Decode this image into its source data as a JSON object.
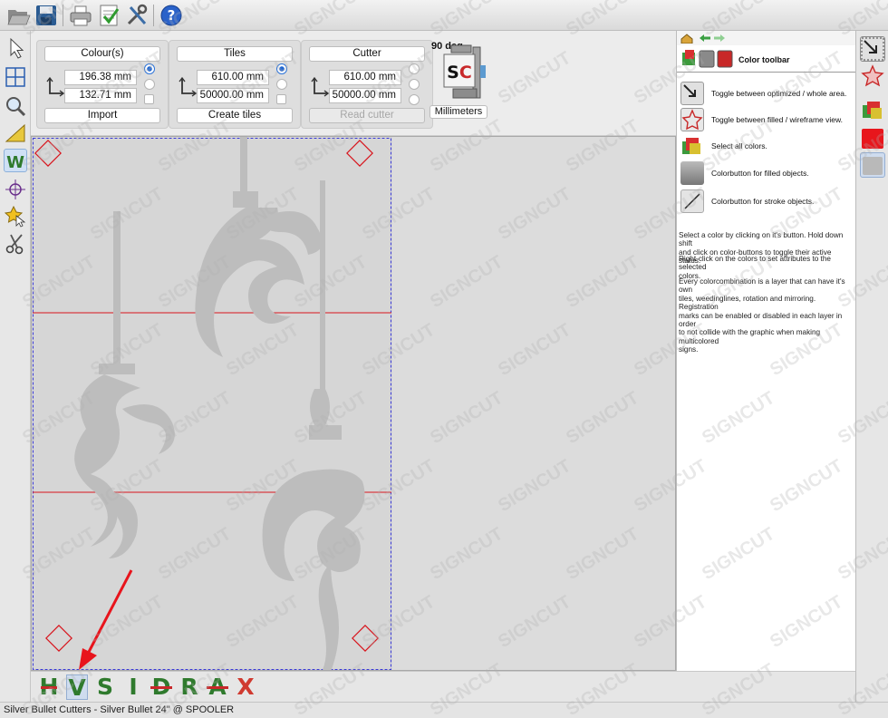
{
  "toolbar": {
    "icons": [
      "folder-open-icon",
      "save-icon",
      "print-icon",
      "checklist-icon",
      "tools-icon",
      "help-icon"
    ]
  },
  "left_tools": [
    "pointer-icon",
    "grid-icon",
    "zoom-icon",
    "ruler-icon",
    "weed-icon",
    "crosshair-icon",
    "star-select-icon",
    "scissors-icon"
  ],
  "params": {
    "colours": {
      "title": "Colour(s)",
      "field1": "196.38 mm",
      "field2": "132.71 mm",
      "button": "Import"
    },
    "tiles": {
      "title": "Tiles",
      "field1": "610.00 mm",
      "field2": "50000.00 mm",
      "button": "Create tiles"
    },
    "cutter": {
      "title": "Cutter",
      "field1": "610.00 mm",
      "field2": "50000.00 mm",
      "button": "Read cutter"
    },
    "rotation": "90 deg",
    "units": "Millimeters"
  },
  "color_bar": {
    "letters": [
      "H",
      "V",
      "S",
      "I",
      "D",
      "R",
      "A",
      "X"
    ],
    "active_index": 1
  },
  "status": "Silver Bullet Cutters - Silver Bullet 24\" @ SPOOLER",
  "help": {
    "title": "Color toolbar",
    "items": [
      "Toggle between optimized / whole area.",
      "Toggle between filled / wireframe view.",
      "Select all colors.",
      "Colorbutton for filled objects.",
      "Colorbutton for stroke objects."
    ],
    "para1_line1": "Select a color by clicking on it's button. Hold down shift",
    "para1_line2": "and click on color-buttons to toggle their active status.",
    "para2_line1": "Right-click on the colors to set attributes to the selected",
    "para2_line2": "colors.",
    "para3_line1": "Every colorcombination is a layer that can have it's own",
    "para3_line2": "tiles, weedinglines, rotation and mirroring. Registration",
    "para3_line3": "marks can be enabled or disabled in each layer in order",
    "para3_line4": "to not collide with the graphic when making multicolored",
    "para3_line5": "signs."
  },
  "color_toolbar": [
    "optimize-area-icon",
    "wireframe-star-icon",
    "all-colors-icon",
    "red-color-swatch",
    "gray-color-swatch"
  ],
  "watermark": "SIGNCUT",
  "colors": {
    "accent": "#2c73d8",
    "registration": "#d8141c",
    "layer_green": "#2f7a2d",
    "layer_red": "#c8282a"
  }
}
